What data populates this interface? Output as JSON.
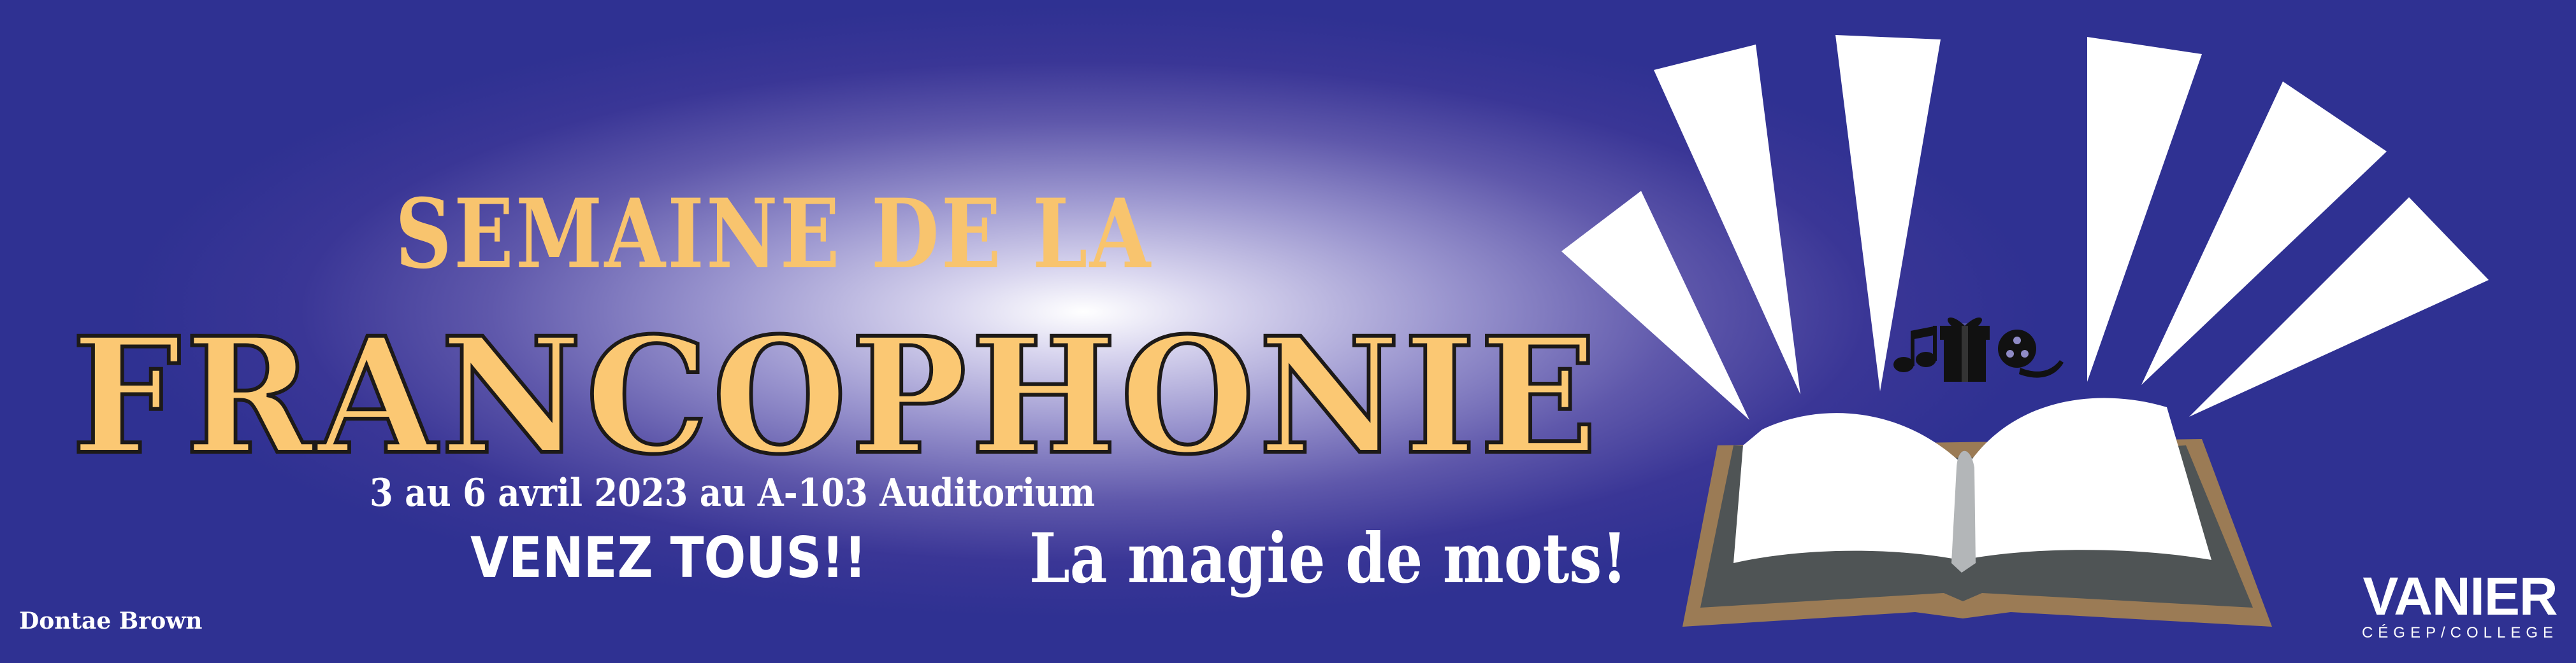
{
  "banner": {
    "title_top": "SEMAINE DE LA",
    "title_main": "FRANCOPHONIE",
    "date_line": "3 au 6 avril 2023 au A-103 Auditorium",
    "cta": "VENEZ TOUS!!",
    "tagline": "La magie de mots!",
    "credit": "Dontae Brown"
  },
  "logo": {
    "name": "VANIER",
    "subtitle": "CÉGEP/COLLEGE"
  },
  "icons": [
    "music-note-icon",
    "gift-icon",
    "film-reel-icon"
  ],
  "colors": {
    "background": "#2f3192",
    "title": "#fbc873",
    "text": "#ffffff",
    "book_cover": "#9b7b55",
    "book_page_edge": "#4f5455",
    "book_spine": "#b3b6b8"
  }
}
